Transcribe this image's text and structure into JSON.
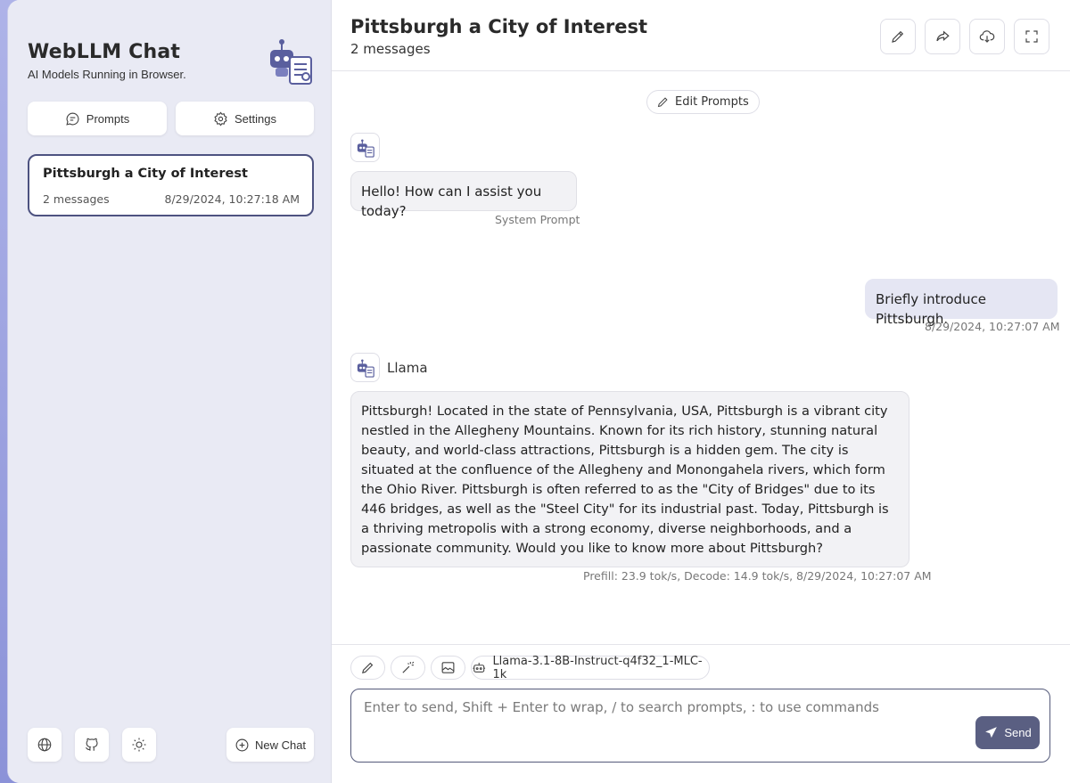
{
  "sidebar": {
    "app_title": "WebLLM Chat",
    "app_subtitle": "AI Models Running in Browser.",
    "prompts_label": "Prompts",
    "settings_label": "Settings",
    "chats": [
      {
        "title": "Pittsburgh a City of Interest",
        "count": "2 messages",
        "time": "8/29/2024, 10:27:18 AM"
      }
    ],
    "new_chat_label": "New Chat",
    "footer_icons": [
      "globe-icon",
      "github-icon",
      "sun-icon"
    ]
  },
  "header": {
    "title": "Pittsburgh a City of Interest",
    "subtitle": "2 messages",
    "buttons": [
      "edit-icon",
      "share-icon",
      "download-icon",
      "fullscreen-icon"
    ]
  },
  "messages": {
    "edit_prompts_label": "Edit Prompts",
    "system": {
      "text": "Hello! How can I assist you today?",
      "meta": "System Prompt"
    },
    "user": {
      "text": "Briefly introduce Pittsburgh.",
      "meta": "8/29/2024, 10:27:07 AM"
    },
    "assistant": {
      "name": "Llama",
      "text": "Pittsburgh! Located in the state of Pennsylvania, USA, Pittsburgh is a vibrant city nestled in the Allegheny Mountains. Known for its rich history, stunning natural beauty, and world-class attractions, Pittsburgh is a hidden gem. The city is situated at the confluence of the Allegheny and Monongahela rivers, which form the Ohio River. Pittsburgh is often referred to as the \"City of Bridges\" due to its 446 bridges, as well as the \"Steel City\" for its industrial past. Today, Pittsburgh is a thriving metropolis with a strong economy, diverse neighborhoods, and a passionate community. Would you like to know more about Pittsburgh?",
      "meta": "Prefill: 23.9 tok/s,  Decode: 14.9 tok/s,  8/29/2024, 10:27:07 AM"
    }
  },
  "input": {
    "model_label": "Llama-3.1-8B-Instruct-q4f32_1-MLC-1k",
    "placeholder": "Enter to send, Shift + Enter to wrap, / to search prompts, : to use commands",
    "value": "",
    "send_label": "Send"
  },
  "colors": {
    "accent": "#5a5f82",
    "sidebar_bg": "#e9eaf4",
    "user_bubble": "#e5e6f3",
    "bot_bubble": "#f2f2f5"
  }
}
